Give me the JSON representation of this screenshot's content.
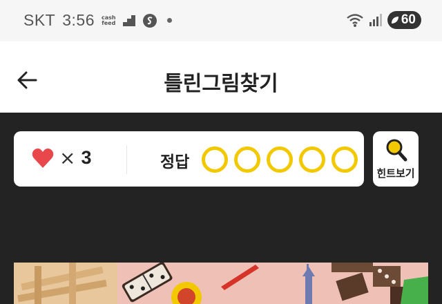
{
  "status_bar": {
    "carrier": "SKT",
    "time": "3:56",
    "app_badge_top": "cash",
    "app_badge_bottom": "feed",
    "battery_level": "60"
  },
  "header": {
    "title": "틀린그림찾기"
  },
  "game_panel": {
    "lives_symbol": "×",
    "lives_count": "3",
    "answer_label": "정답",
    "answers_total": 5,
    "answers_found": 0
  },
  "hint_button": {
    "label": "힌트보기"
  },
  "colors": {
    "accent_yellow": "#f2c800",
    "heart_red": "#e8474c",
    "background_dark": "#232323"
  }
}
